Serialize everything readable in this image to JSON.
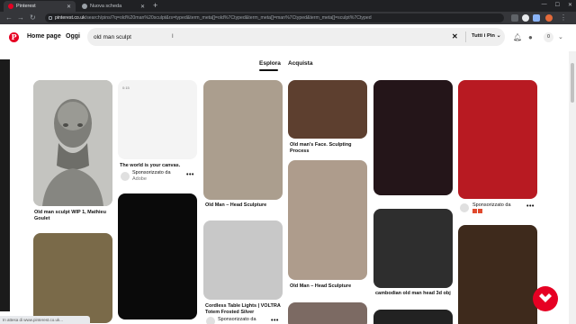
{
  "browser": {
    "tabs": [
      {
        "label": "Pinterest",
        "icon": "pinterest-favicon",
        "color": "#e60023"
      },
      {
        "label": "Nuova scheda",
        "icon": "globe-icon",
        "color": "#9aa0a6"
      }
    ],
    "url_host": "pinterest.co.uk",
    "url_path": "/search/pins/?q=old%20man%20sculpt&rs=typed&term_meta[]=old%7Ctyped&term_meta[]=man%7Ctyped&term_meta[]=sculpt%7Ctyped",
    "status_text": "In attesa di www.pinterest.co.uk..."
  },
  "header": {
    "home_label": "Home page",
    "today_label": "Oggi",
    "search_value": "old man sculpt",
    "filter_label": "Tutti i Pin",
    "notif_count": "0",
    "brand_color": "#e60023"
  },
  "subtabs": {
    "explore": "Esplora",
    "shop": "Acquista"
  },
  "pins": {
    "c1a": {
      "title": "Old man sculpt WIP 1, Mathieu Goulet"
    },
    "c2a": {
      "small": "0:15",
      "title": "The world is your canvas.",
      "sponsored": "Sponsorizzato da",
      "by": "Adobe"
    },
    "c2c": {
      "title": "Cordless Table Lights | VOLTRA Totem Frosted Silver",
      "sponsored": "Sponsorizzato da"
    },
    "c3a": {
      "title": "Old Man – Head Sculpture"
    },
    "c4a": {
      "title": "Old man's Face. Sculpting Process"
    },
    "c4b": {
      "title": "Old Man – Head Sculpture"
    },
    "c5b": {
      "title": "cambodian old man head 3d obj"
    },
    "c6a": {
      "sponsored": "Sponsorizzato da"
    }
  }
}
